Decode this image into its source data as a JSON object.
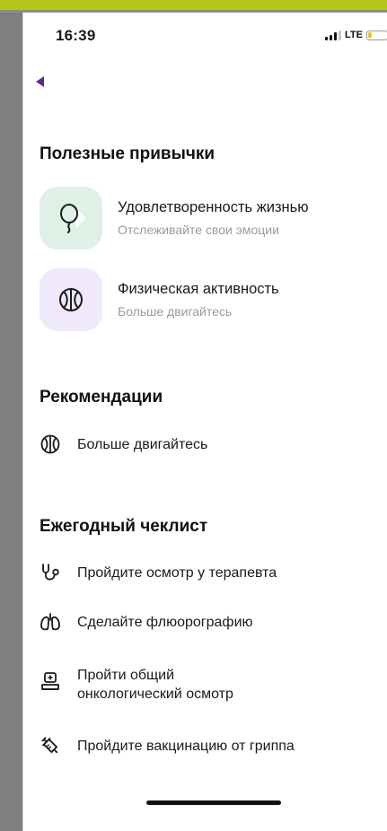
{
  "status_bar": {
    "time": "16:39",
    "network": "LTE"
  },
  "habits": {
    "title": "Полезные привычки",
    "items": [
      {
        "title": "Удовлетворенность жизнью",
        "subtitle": "Отслеживайте свои эмоции",
        "icon": "balloon-icon",
        "tile_color": "#dff0e6"
      },
      {
        "title": "Физическая активность",
        "subtitle": "Больше двигайтесь",
        "icon": "basketball-icon",
        "tile_color": "#efe9fb"
      }
    ]
  },
  "recommendations": {
    "title": "Рекомендации",
    "items": [
      {
        "label": "Больше двигайтесь",
        "icon": "basketball-icon"
      }
    ]
  },
  "checklist": {
    "title": "Ежегодный чеклист",
    "items": [
      {
        "label": "Пройдите осмотр у терапевта",
        "icon": "stethoscope-icon"
      },
      {
        "label": "Сделайте флюорографию",
        "icon": "lungs-icon"
      },
      {
        "label_line1": "Пройти общий",
        "label_line2": "онкологический осмотр",
        "icon": "medical-checkup-icon"
      },
      {
        "label": "Пройдите вакцинацию от гриппа",
        "icon": "syringe-icon"
      }
    ]
  },
  "colors": {
    "accent": "#b7c61c",
    "back_arrow": "#5b2d8e"
  }
}
